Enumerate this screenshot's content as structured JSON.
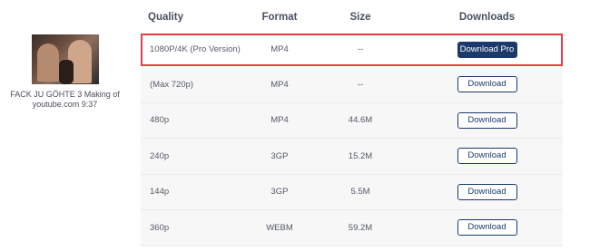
{
  "video": {
    "title_line1": "FACK JU GÖHTE 3 Making of",
    "title_line2": "youtube.com 9:37"
  },
  "table": {
    "headers": {
      "quality": "Quality",
      "format": "Format",
      "size": "Size",
      "downloads": "Downloads"
    },
    "rows": [
      {
        "quality": "1080P/4K (Pro Version)",
        "format": "MP4",
        "size": "--",
        "button": "Download Pro"
      },
      {
        "quality": "(Max 720p)",
        "format": "MP4",
        "size": "--",
        "button": "Download"
      },
      {
        "quality": "480p",
        "format": "MP4",
        "size": "44.6M",
        "button": "Download"
      },
      {
        "quality": "240p",
        "format": "3GP",
        "size": "15.2M",
        "button": "Download"
      },
      {
        "quality": "144p",
        "format": "3GP",
        "size": "5.5M",
        "button": "Download"
      },
      {
        "quality": "360p",
        "format": "WEBM",
        "size": "59.2M",
        "button": "Download"
      }
    ]
  },
  "colors": {
    "primary": "#1b3a6b",
    "highlight_border": "#e43d3d",
    "row_bg": "#f7f7f8"
  }
}
